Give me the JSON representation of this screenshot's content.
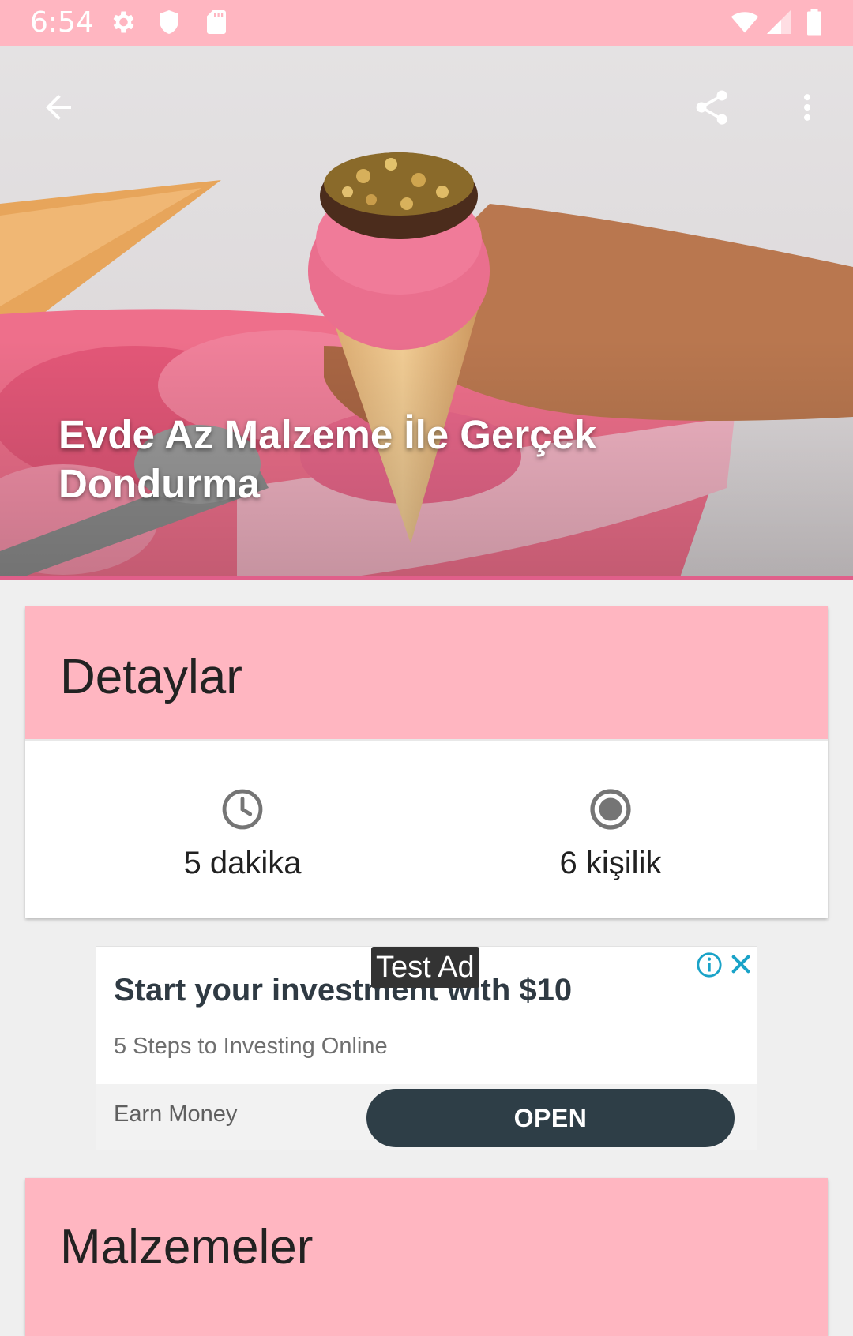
{
  "status_bar": {
    "time": "6:54",
    "left_icons": [
      "gear-icon",
      "shield-icon",
      "sd-card-icon"
    ],
    "right_icons": [
      "wifi-icon",
      "signal-icon",
      "battery-icon"
    ],
    "background": "#ffb6c1"
  },
  "toolbar": {
    "back_icon": "arrow-left-icon",
    "share_icon": "share-icon",
    "more_icon": "more-vertical-icon"
  },
  "recipe": {
    "title": "Evde Az Malzeme İle Gerçek Dondurma",
    "image": "ice-cream-cone-photo"
  },
  "details": {
    "header": "Detaylar",
    "time_icon": "clock-icon",
    "time": "5 dakika",
    "servings_icon": "radio-button-icon",
    "servings": "6 kişilik"
  },
  "ad": {
    "badge": "Test Ad",
    "headline": "Start your investment with $10",
    "subtext": "5 Steps to Investing Online",
    "advertiser": "Earn Money",
    "cta": "OPEN",
    "info_icon": "info-icon",
    "close_icon": "close-icon"
  },
  "ingredients": {
    "header": "Malzemeler"
  },
  "colors": {
    "accent_pink": "#ffb6c1",
    "accent_line": "#e05f8a",
    "cta_dark": "#2e3e47"
  }
}
